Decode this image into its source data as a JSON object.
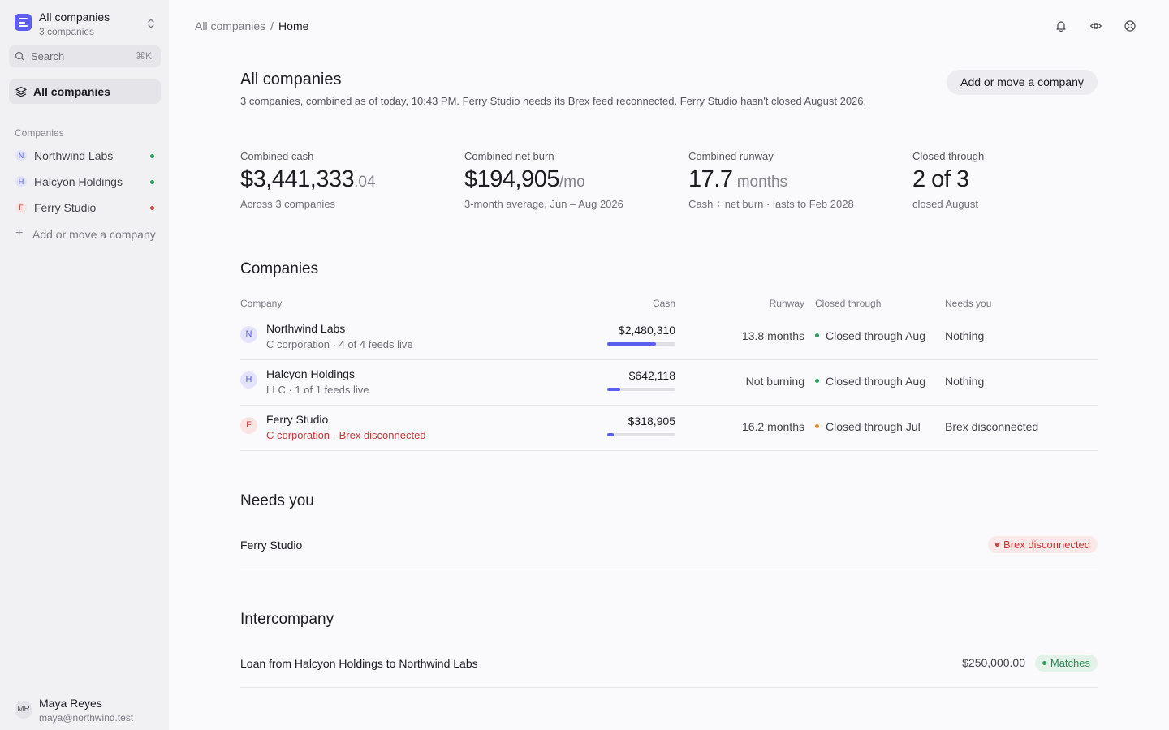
{
  "sidebar": {
    "switcher": {
      "title": "All companies",
      "subtitle": "3 companies"
    },
    "search": {
      "placeholder": "Search",
      "shortcut": "⌘K"
    },
    "nav_active_label": "All companies",
    "companies_title": "Companies",
    "companies": [
      {
        "initial": "N",
        "name": "Northwind Labs",
        "status": "green"
      },
      {
        "initial": "H",
        "name": "Halcyon Holdings",
        "status": "green"
      },
      {
        "initial": "F",
        "name": "Ferry Studio",
        "status": "red"
      }
    ],
    "add_label": "Add or move a company",
    "user": {
      "initials": "MR",
      "name": "Maya Reyes",
      "email": "maya@northwind.test"
    }
  },
  "breadcrumb": {
    "root": "All companies",
    "separator": "/",
    "current": "Home"
  },
  "topbar_icons": [
    "bell-icon",
    "eye-icon",
    "settings-icon"
  ],
  "header": {
    "title": "All companies",
    "subtitle": "3 companies, combined as of today, 10:43 PM. Ferry Studio needs its Brex feed reconnected. Ferry Studio hasn't closed August 2026.",
    "add_button": "Add or move a company"
  },
  "stats": [
    {
      "label": "Combined cash",
      "value": "$3,441,333",
      "suffix": ".04",
      "note": "Across 3 companies"
    },
    {
      "label": "Combined net burn",
      "value": "$194,905",
      "suffix": "/mo",
      "note": "3-month average, Jun – Aug 2026"
    },
    {
      "label": "Combined runway",
      "value": "17.7",
      "suffix": " months",
      "note": "Cash ÷ net burn · lasts to Feb 2028"
    },
    {
      "label": "Closed through",
      "value": "2 of 3",
      "suffix": "",
      "note": "closed August"
    }
  ],
  "companies_section": {
    "title": "Companies",
    "columns": {
      "company": "Company",
      "cash": "Cash",
      "runway": "Runway",
      "closed": "Closed through",
      "needs": "Needs you"
    },
    "rows": [
      {
        "initial": "N",
        "name": "Northwind Labs",
        "meta": "C corporation · 4 of 4 feeds live",
        "meta_alert": false,
        "cash": "$2,480,310",
        "cash_share": 0.72,
        "runway": "13.8 months",
        "closed": "Closed through Aug",
        "closed_color": "#2f9e5f",
        "needs": "Nothing"
      },
      {
        "initial": "H",
        "name": "Halcyon Holdings",
        "meta": "LLC · 1 of 1 feeds live",
        "meta_alert": false,
        "cash": "$642,118",
        "cash_share": 0.19,
        "runway": "Not burning",
        "closed": "Closed through Aug",
        "closed_color": "#2f9e5f",
        "needs": "Nothing"
      },
      {
        "initial": "F",
        "name": "Ferry Studio",
        "meta": "C corporation · Brex disconnected",
        "meta_alert": true,
        "cash": "$318,905",
        "cash_share": 0.09,
        "runway": "16.2 months",
        "closed": "Closed through Jul",
        "closed_color": "#e08a2e",
        "needs": "Brex disconnected"
      }
    ]
  },
  "needs_section": {
    "title": "Needs you",
    "items": [
      {
        "name": "Ferry Studio",
        "badge": "Brex disconnected"
      }
    ]
  },
  "intercompany_section": {
    "title": "Intercompany",
    "items": [
      {
        "name": "Loan from Halcyon Holdings to Northwind Labs",
        "amount": "$250,000.00",
        "badge": "Matches"
      }
    ]
  },
  "colors": {
    "accent": "#5b5ef0",
    "ok": "#2f9e5f",
    "warn": "#e08a2e",
    "error": "#d04040"
  }
}
